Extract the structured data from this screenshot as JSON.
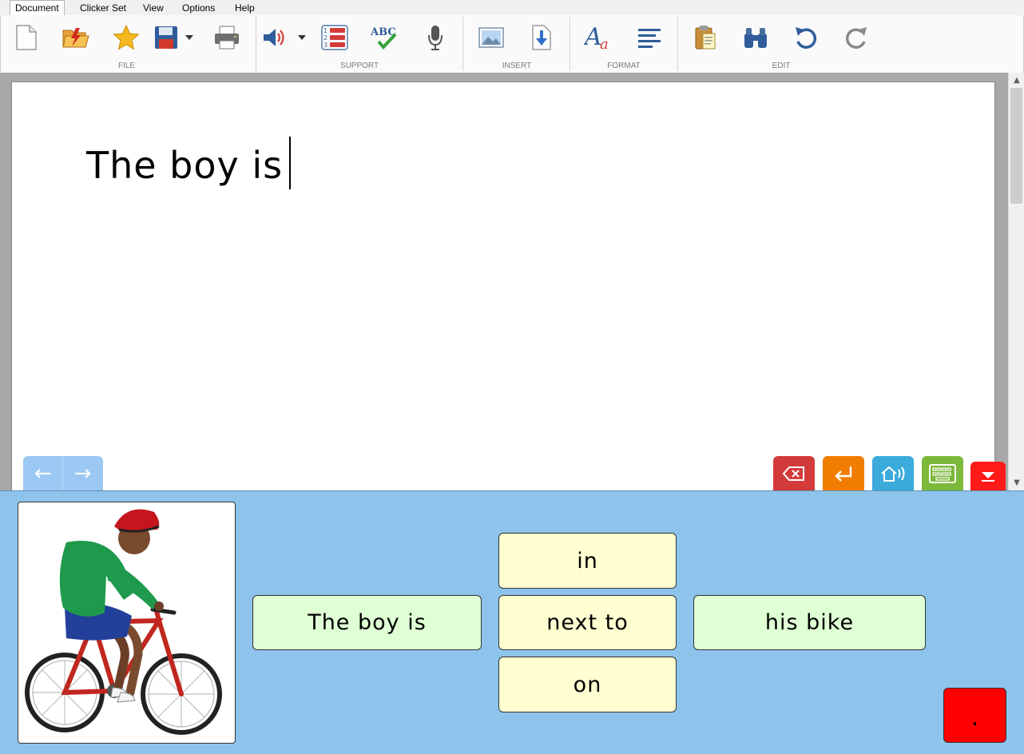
{
  "menu": {
    "tabs": [
      "Document",
      "Clicker Set",
      "View",
      "Options",
      "Help"
    ]
  },
  "ribbon": {
    "groups": {
      "file": "FILE",
      "support": "SUPPORT",
      "insert": "INSERT",
      "format": "FORMAT",
      "edit": "EDIT"
    },
    "icons": {
      "new": "new-document-icon",
      "open": "open-folder-icon",
      "favorite": "star-icon",
      "save": "save-icon",
      "print": "print-icon",
      "speak": "speaker-icon",
      "list": "numbered-list-icon",
      "spell": "spellcheck-icon",
      "spell_text": "ABC",
      "record": "microphone-icon",
      "picture": "picture-icon",
      "insert_file": "insert-file-icon",
      "font": "font-icon",
      "align": "align-left-icon",
      "paste": "paste-icon",
      "find": "binoculars-icon",
      "undo": "undo-icon",
      "redo": "redo-icon"
    }
  },
  "document": {
    "text": "The boy is"
  },
  "nav": {
    "back": "←",
    "forward": "→"
  },
  "actions": {
    "colors": {
      "delete": "#d33b3b",
      "enter": "#f07d00",
      "speak": "#3aabdb",
      "keyboard": "#7cb93b",
      "hide": "#ff1a1a"
    }
  },
  "clicker": {
    "picture": "boy-on-bike-picture",
    "cells": {
      "subject": "The boy is",
      "prep_in": "in",
      "prep_next_to": "next to",
      "prep_on": "on",
      "object": "his bike",
      "period": "."
    },
    "colors": {
      "subject": "#dfffd5",
      "preposition": "#ffffd2",
      "period": "#ff0000",
      "panel": "#8ec4ec"
    }
  }
}
